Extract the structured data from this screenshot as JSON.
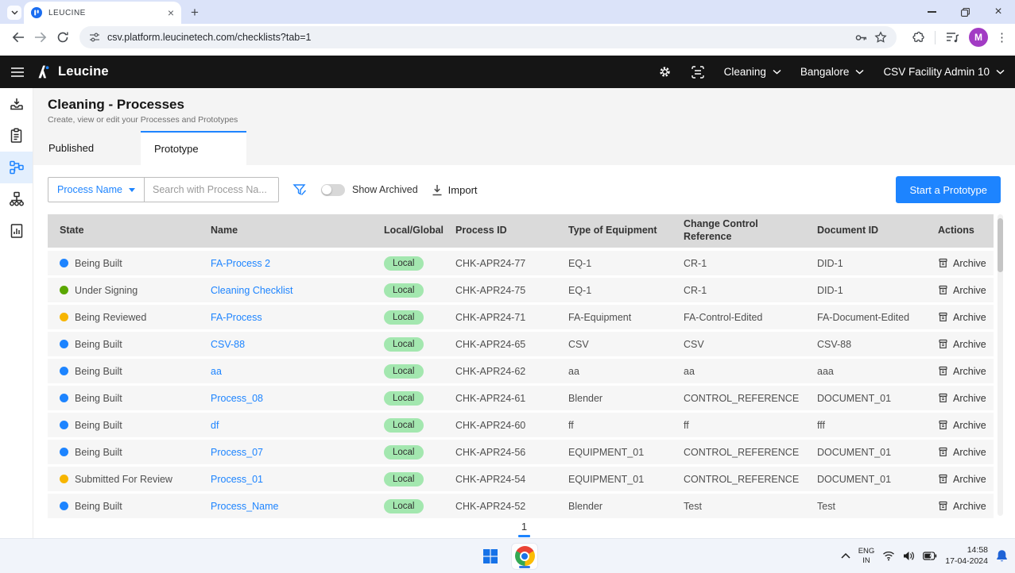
{
  "browser": {
    "tab_title": "LEUCINE",
    "url": "csv.platform.leucinetech.com/checklists?tab=1",
    "new_tab_glyph": "+",
    "close_tab_glyph": "×",
    "avatar_initial": "M",
    "more_menu_glyph": "⋮",
    "window_close_glyph": "×"
  },
  "navbar": {
    "brand": "Leucine",
    "menus": [
      {
        "label": "Cleaning"
      },
      {
        "label": "Bangalore"
      },
      {
        "label": "CSV Facility Admin 10"
      }
    ]
  },
  "sidebar": {
    "items": [
      {
        "icon": "inbox-tray-icon",
        "active": false
      },
      {
        "icon": "checklist-clipboard-icon",
        "active": false
      },
      {
        "icon": "process-flow-icon",
        "active": true
      },
      {
        "icon": "sitemap-icon",
        "active": false
      },
      {
        "icon": "report-document-icon",
        "active": false
      }
    ]
  },
  "page": {
    "title": "Cleaning - Processes",
    "subtitle": "Create, view or edit your Processes and Prototypes",
    "tabs": [
      {
        "label": "Published",
        "active": false
      },
      {
        "label": "Prototype",
        "active": true
      }
    ]
  },
  "filters": {
    "dropdown_label": "Process Name",
    "search_placeholder": "Search with Process Na...",
    "show_archived_label": "Show Archived",
    "show_archived_on": false,
    "import_label": "Import",
    "start_button_label": "Start a Prototype"
  },
  "table": {
    "headers": [
      "State",
      "Name",
      "Local/Global",
      "Process ID",
      "Type of Equipment",
      "Change Control Reference",
      "Document ID",
      "Actions"
    ],
    "action_label": "Archive",
    "rows": [
      {
        "state": "Being Built",
        "state_color": "#1d84ff",
        "name": "FA-Process 2",
        "scope": "Local",
        "process_id": "CHK-APR24-77",
        "equipment": "EQ-1",
        "change_control": "CR-1",
        "document_id": "DID-1"
      },
      {
        "state": "Under Signing",
        "state_color": "#5aa700",
        "name": "Cleaning Checklist",
        "scope": "Local",
        "process_id": "CHK-APR24-75",
        "equipment": "EQ-1",
        "change_control": "CR-1",
        "document_id": "DID-1"
      },
      {
        "state": "Being Reviewed",
        "state_color": "#f7b500",
        "name": "FA-Process",
        "scope": "Local",
        "process_id": "CHK-APR24-71",
        "equipment": "FA-Equipment",
        "change_control": "FA-Control-Edited",
        "document_id": "FA-Document-Edited"
      },
      {
        "state": "Being Built",
        "state_color": "#1d84ff",
        "name": "CSV-88",
        "scope": "Local",
        "process_id": "CHK-APR24-65",
        "equipment": "CSV",
        "change_control": "CSV",
        "document_id": "CSV-88"
      },
      {
        "state": "Being Built",
        "state_color": "#1d84ff",
        "name": "aa",
        "scope": "Local",
        "process_id": "CHK-APR24-62",
        "equipment": "aa",
        "change_control": "aa",
        "document_id": "aaa"
      },
      {
        "state": "Being Built",
        "state_color": "#1d84ff",
        "name": "Process_08",
        "scope": "Local",
        "process_id": "CHK-APR24-61",
        "equipment": "Blender",
        "change_control": "CONTROL_REFERENCE",
        "document_id": "DOCUMENT_01"
      },
      {
        "state": "Being Built",
        "state_color": "#1d84ff",
        "name": "df",
        "scope": "Local",
        "process_id": "CHK-APR24-60",
        "equipment": "ff",
        "change_control": "ff",
        "document_id": "fff"
      },
      {
        "state": "Being Built",
        "state_color": "#1d84ff",
        "name": "Process_07",
        "scope": "Local",
        "process_id": "CHK-APR24-56",
        "equipment": "EQUIPMENT_01",
        "change_control": "CONTROL_REFERENCE",
        "document_id": "DOCUMENT_01"
      },
      {
        "state": "Submitted For Review",
        "state_color": "#f7b500",
        "name": "Process_01",
        "scope": "Local",
        "process_id": "CHK-APR24-54",
        "equipment": "EQUIPMENT_01",
        "change_control": "CONTROL_REFERENCE",
        "document_id": "DOCUMENT_01"
      },
      {
        "state": "Being Built",
        "state_color": "#1d84ff",
        "name": "Process_Name",
        "scope": "Local",
        "process_id": "CHK-APR24-52",
        "equipment": "Blender",
        "change_control": "Test",
        "document_id": "Test"
      }
    ]
  },
  "pagination": {
    "current_page": "1"
  },
  "taskbar": {
    "language_line1": "ENG",
    "language_line2": "IN",
    "time": "14:58",
    "date": "17-04-2024"
  },
  "colors": {
    "accent_blue": "#1d84ff",
    "state_blue": "#1d84ff",
    "state_green": "#5aa700",
    "state_amber": "#f7b500",
    "scope_pill_bg": "#a3e7af",
    "navbar_bg": "#151515",
    "header_bg": "#dadada",
    "row_bg": "#f6f6f6"
  },
  "icons": {
    "leucine-favicon": "blue circle with white bars",
    "leucine-logo": "white lambda with blue dot",
    "hamburger-icon": "three lines",
    "gear-icon": "settings gear",
    "scan-icon": "frame with lines",
    "chevron-down-icon": "v",
    "filter-funnel-icon": "funnel with slash",
    "download-icon": "arrow into line",
    "archive-icon": "storage box",
    "windows-start-icon": "four squares",
    "chrome-icon": "chrome circle",
    "wifi-icon": "arcs",
    "volume-icon": "speaker",
    "battery-icon": "battery charging",
    "bell-icon": "notification bell"
  }
}
